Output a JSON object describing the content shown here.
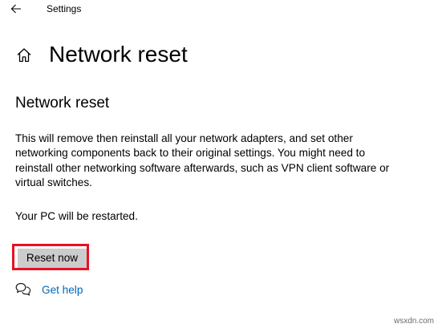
{
  "window": {
    "title": "Settings"
  },
  "header": {
    "title": "Network reset",
    "back_icon": "back-arrow-icon",
    "home_icon": "home-icon"
  },
  "section": {
    "title": "Network reset",
    "description": "This will remove then reinstall all your network adapters, and set other networking components back to their original settings. You might need to reinstall other networking software afterwards, such as VPN client software or virtual switches.",
    "restart_note": "Your PC will be restarted.",
    "reset_button_label": "Reset now",
    "highlight_color": "#e81123"
  },
  "help": {
    "icon": "get-help-icon",
    "link_label": "Get help",
    "link_color": "#0067b8"
  },
  "watermark": {
    "text": "wsxdn.com"
  }
}
